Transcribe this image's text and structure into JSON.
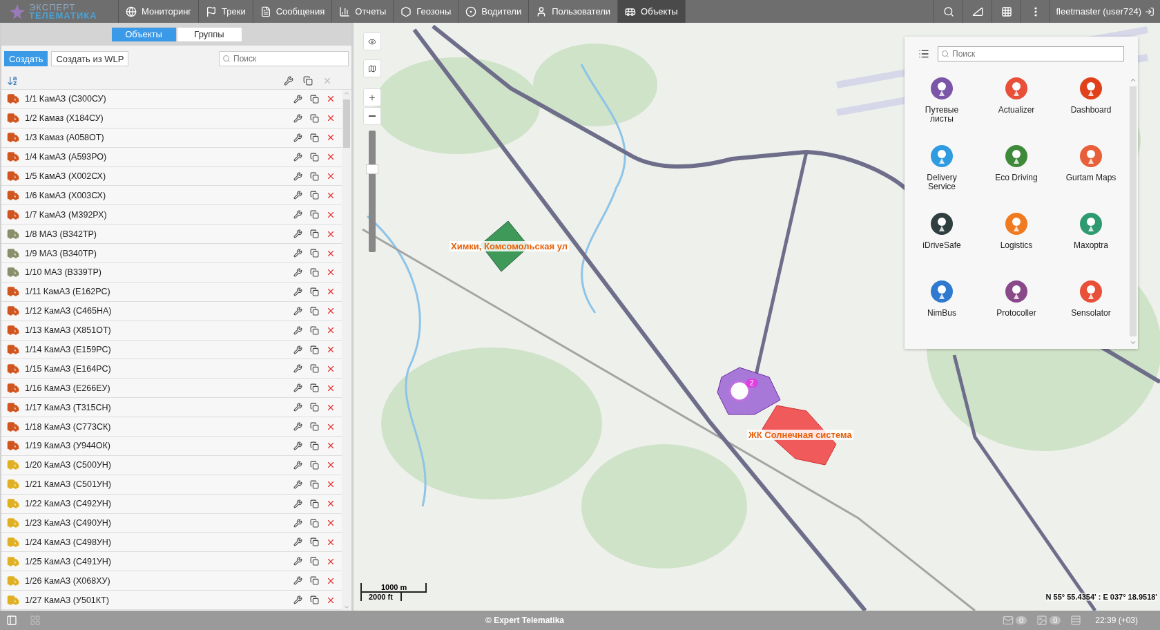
{
  "header": {
    "logo_top": "ЭКСПЕРТ",
    "logo_bottom": "ТЕЛЕМАТИКА",
    "nav": [
      {
        "label": "Мониторинг",
        "selected": false
      },
      {
        "label": "Треки",
        "selected": false
      },
      {
        "label": "Сообщения",
        "selected": false
      },
      {
        "label": "Отчеты",
        "selected": false
      },
      {
        "label": "Геозоны",
        "selected": false
      },
      {
        "label": "Водители",
        "selected": false
      },
      {
        "label": "Пользователи",
        "selected": false
      },
      {
        "label": "Объекты",
        "selected": true
      }
    ],
    "user": "fleetmaster (user724)"
  },
  "left_panel": {
    "tabs": [
      {
        "label": "Объекты",
        "selected": true
      },
      {
        "label": "Группы",
        "selected": false
      }
    ],
    "buttons": [
      {
        "label": "Создать",
        "primary": true
      },
      {
        "label": "Создать из WLP",
        "primary": false
      }
    ],
    "search": {
      "placeholder": "Поиск"
    },
    "objects": [
      {
        "name": "1/1 КамАЗ (С300СУ)",
        "color": "#d2541e"
      },
      {
        "name": "1/2 Камаз (Х184СУ)",
        "color": "#d2541e"
      },
      {
        "name": "1/3 Камаз (А058ОТ)",
        "color": "#d2541e"
      },
      {
        "name": "1/4 КамАЗ (А593РО)",
        "color": "#d2541e"
      },
      {
        "name": "1/5 КамАЗ (Х002СХ)",
        "color": "#d2541e"
      },
      {
        "name": "1/6 КамАЗ (Х003СХ)",
        "color": "#d2541e"
      },
      {
        "name": "1/7 КамАЗ (М392РХ)",
        "color": "#d2541e"
      },
      {
        "name": "1/8 МАЗ (В342ТР)",
        "color": "#8a8f6a"
      },
      {
        "name": "1/9 МАЗ (В340ТР)",
        "color": "#8a8f6a"
      },
      {
        "name": "1/10 МАЗ (В339ТР)",
        "color": "#8a8f6a"
      },
      {
        "name": "1/11 КамАЗ (Е162РС)",
        "color": "#d2541e"
      },
      {
        "name": "1/12 КамАЗ (С465НА)",
        "color": "#d2541e"
      },
      {
        "name": "1/13 КамАЗ (Х851ОТ)",
        "color": "#d2541e"
      },
      {
        "name": "1/14 КамАЗ (Е159РС)",
        "color": "#d2541e"
      },
      {
        "name": "1/15 КамАЗ (Е164РС)",
        "color": "#d2541e"
      },
      {
        "name": "1/16 КамАЗ (Е266ЕУ)",
        "color": "#d2541e"
      },
      {
        "name": "1/17 КамАЗ (Т315СН)",
        "color": "#d2541e"
      },
      {
        "name": "1/18 КамАЗ (С773СК)",
        "color": "#d2541e"
      },
      {
        "name": "1/19 КамАЗ (У944ОК)",
        "color": "#d2541e"
      },
      {
        "name": "1/20 КамАЗ (С500УН)",
        "color": "#e0b020"
      },
      {
        "name": "1/21 КамАЗ (С501УН)",
        "color": "#e0b020"
      },
      {
        "name": "1/22 КамАЗ (С492УН)",
        "color": "#e0b020"
      },
      {
        "name": "1/23 КамАЗ (С490УН)",
        "color": "#e0b020"
      },
      {
        "name": "1/24 КамАЗ (С498УН)",
        "color": "#e0b020"
      },
      {
        "name": "1/25 КамАЗ (С491УН)",
        "color": "#e0b020"
      },
      {
        "name": "1/26 КамАЗ (Х068ХУ)",
        "color": "#e0b020"
      },
      {
        "name": "1/27 КамАЗ (У501КТ)",
        "color": "#e0b020"
      }
    ]
  },
  "map": {
    "geofences": [
      {
        "label": "Химки, Комсомольская ул",
        "color": "#3f9a5a"
      },
      {
        "label": "ЖК Солнечная система",
        "color": "#f05a5a"
      }
    ],
    "cluster_count": "2",
    "zoom": {
      "level": 0.7
    },
    "scale_metric": "1000 m",
    "scale_imperial": "2000 ft",
    "coordinates": "N 55° 55.4354' : E 037° 18.9518'"
  },
  "apps_panel": {
    "search": {
      "placeholder": "Поиск"
    },
    "apps": [
      {
        "label": "Путевые листы",
        "color": "#7b55a8"
      },
      {
        "label": "Actualizer",
        "color": "#e8503a"
      },
      {
        "label": "Dashboard",
        "color": "#e0401a"
      },
      {
        "label": "Delivery Service",
        "color": "#2f9be0"
      },
      {
        "label": "Eco Driving",
        "color": "#3f8a3a"
      },
      {
        "label": "Gurtam Maps",
        "color": "#e8603a"
      },
      {
        "label": "iDriveSafe",
        "color": "#2f3f3f"
      },
      {
        "label": "Logistics",
        "color": "#f07a20"
      },
      {
        "label": "Maxoptra",
        "color": "#2f9a70"
      },
      {
        "label": "NimBus",
        "color": "#2f7ad0"
      },
      {
        "label": "Protocoller",
        "color": "#8a4a8a"
      },
      {
        "label": "Sensolator",
        "color": "#e8503a"
      }
    ]
  },
  "status_bar": {
    "copyright": "© Expert Telematika",
    "messages_count": "0",
    "notifications_count": "0",
    "time": "22:39 (+03)"
  }
}
